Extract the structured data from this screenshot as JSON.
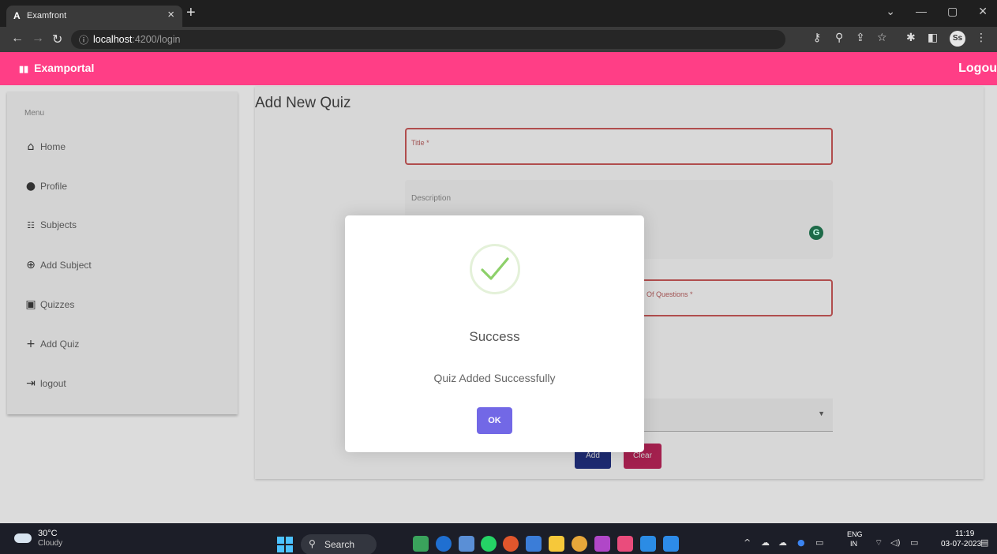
{
  "browser": {
    "tab_title": "Examfront",
    "tab_favicon": "A",
    "url_host": "localhost",
    "url_path": ":4200/login",
    "profile_initials": "Ss"
  },
  "app": {
    "brand": "Examportal",
    "logout_top": "Logou",
    "accent_color": "#ff3e86"
  },
  "sidebar": {
    "title": "Menu",
    "items": [
      {
        "label": "Home",
        "icon": "home-icon"
      },
      {
        "label": "Profile",
        "icon": "profile-icon"
      },
      {
        "label": "Subjects",
        "icon": "list-icon"
      },
      {
        "label": "Add Subject",
        "icon": "add-circle-icon"
      },
      {
        "label": "Quizzes",
        "icon": "quiz-icon"
      },
      {
        "label": "Add Quiz",
        "icon": "plus-icon"
      },
      {
        "label": "logout",
        "icon": "logout-icon"
      }
    ]
  },
  "form": {
    "page_title": "Add New Quiz",
    "title_label": "Title *",
    "description_label": "Description",
    "questions_label": "Of Questions *",
    "add_label": "Add",
    "clear_label": "Clear"
  },
  "modal": {
    "title": "Success",
    "message": "Quiz Added Successfully",
    "ok_label": "OK",
    "icon": "check-icon"
  },
  "taskbar": {
    "temperature": "30°C",
    "condition": "Cloudy",
    "search_label": "Search",
    "lang1": "ENG",
    "lang2": "IN",
    "time": "11:19",
    "date": "03-07-2023"
  }
}
